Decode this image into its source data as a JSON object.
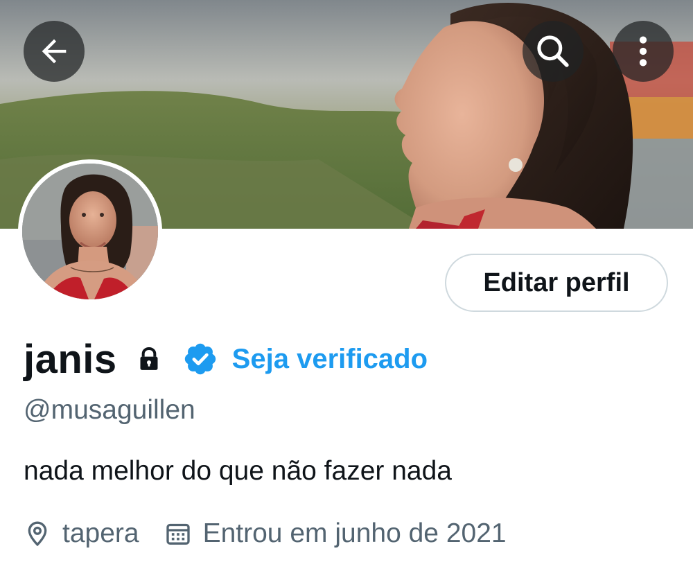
{
  "header": {
    "back_icon": "arrow-left-icon",
    "search_icon": "search-icon",
    "more_icon": "more-vertical-icon"
  },
  "profile": {
    "display_name": "janis",
    "protected_icon": "lock-icon",
    "verified_icon": "verified-badge-icon",
    "verify_link": "Seja verificado",
    "handle": "@musaguillen",
    "bio": "nada melhor do que não fazer nada",
    "location_icon": "location-pin-icon",
    "location": "tapera",
    "joined_icon": "calendar-icon",
    "joined": "Entrou em junho de 2021",
    "edit_button": "Editar perfil"
  },
  "colors": {
    "accent": "#1d9bf0",
    "text_primary": "#0f1419",
    "text_secondary": "#536471",
    "button_border": "#cfd9de"
  }
}
